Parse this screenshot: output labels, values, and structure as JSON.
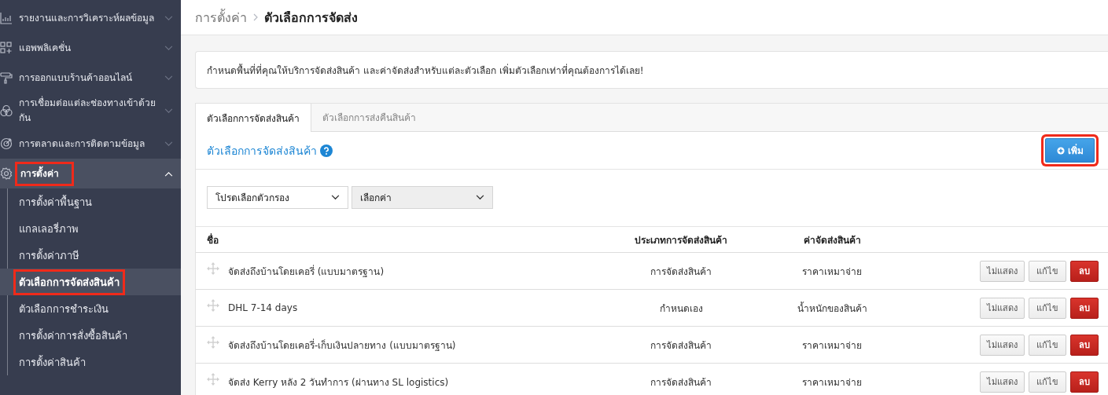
{
  "sidebar": {
    "items": [
      {
        "kind": "chart",
        "label": "รายงานและการวิเคราะห์ผลข้อมูล",
        "expanded": false,
        "selected": false,
        "highlighted": false
      },
      {
        "kind": "apps",
        "label": "แอพพลิเคชั่น",
        "expanded": false,
        "selected": false,
        "highlighted": false
      },
      {
        "kind": "roller",
        "label": "การออกแบบร้านค้าออนไลน์",
        "expanded": false,
        "selected": false,
        "highlighted": false
      },
      {
        "kind": "circles",
        "label": "การเชื่อมต่อแต่ละช่องทางเข้าด้วยกัน",
        "expanded": false,
        "selected": false,
        "highlighted": false
      },
      {
        "kind": "target",
        "label": "การตลาดและการติดตามข้อมูล",
        "expanded": false,
        "selected": false,
        "highlighted": false
      },
      {
        "kind": "gear",
        "label": "การตั้งค่า",
        "expanded": true,
        "selected": true,
        "highlighted": true,
        "children": [
          {
            "label": "การตั้งค่าพื้นฐาน",
            "selected": false,
            "highlighted": false
          },
          {
            "label": "แกลเลอรี่ภาพ",
            "selected": false,
            "highlighted": false
          },
          {
            "label": "การตั้งค่าภาษี",
            "selected": false,
            "highlighted": false
          },
          {
            "label": "ตัวเลือกการจัดส่งสินค้า",
            "selected": true,
            "highlighted": true
          },
          {
            "label": "ตัวเลือกการชำระเงิน",
            "selected": false,
            "highlighted": false
          },
          {
            "label": "การตั้งค่าการสั่งซื้อสินค้า",
            "selected": false,
            "highlighted": false
          },
          {
            "label": "การตั้งค่าสินค้า",
            "selected": false,
            "highlighted": false
          }
        ]
      }
    ]
  },
  "breadcrumb": [
    "การตั้งค่า",
    "ตัวเลือกการจัดส่ง"
  ],
  "info": "กำหนดพื้นที่ที่คุณให้บริการจัดส่งสินค้า และค่าจัดส่งสำหรับแต่ละตัวเลือก เพิ่มตัวเลือกเท่าที่คุณต้องการได้เลย!",
  "tabs": [
    {
      "label": "ตัวเลือกการจัดส่งสินค้า",
      "selected": true
    },
    {
      "label": "ตัวเลือกการส่งคืนสินค้า",
      "selected": false
    }
  ],
  "section": {
    "title": "ตัวเลือกการจัดส่งสินค้า",
    "add_button": {
      "label": "เพิ่ม",
      "highlighted": true
    }
  },
  "filters": [
    {
      "value": "โปรดเลือกตัวกรอง",
      "disabled": false
    },
    {
      "value": "เลือกค่า",
      "disabled": true
    }
  ],
  "table": {
    "columns": [
      "ชื่อ",
      "ประเภทการจัดส่งสินค้า",
      "ค่าจัดส่งสินค้า"
    ],
    "rows": [
      {
        "name": "จัดส่งถึงบ้านโดยเคอรี่ (แบบมาตรฐาน)",
        "type": "การจัดส่งสินค้า",
        "fee": "ราคาเหมาจ่าย",
        "actions": [
          {
            "kind": "default",
            "label": "ไม่แสดง"
          },
          {
            "kind": "default",
            "label": "แก้ไข"
          },
          {
            "kind": "danger",
            "label": "ลบ"
          }
        ]
      },
      {
        "name": "DHL 7-14 days",
        "type": "กำหนดเอง",
        "fee": "น้ำหนักของสินค้า",
        "actions": [
          {
            "kind": "default",
            "label": "ไม่แสดง"
          },
          {
            "kind": "default",
            "label": "แก้ไข"
          },
          {
            "kind": "danger",
            "label": "ลบ"
          }
        ]
      },
      {
        "name": "จัดส่งถึงบ้านโดยเคอรี่-เก็บเงินปลายทาง (แบบมาตรฐาน)",
        "type": "การจัดส่งสินค้า",
        "fee": "ราคาเหมาจ่าย",
        "actions": [
          {
            "kind": "default",
            "label": "ไม่แสดง"
          },
          {
            "kind": "default",
            "label": "แก้ไข"
          },
          {
            "kind": "danger",
            "label": "ลบ"
          }
        ]
      },
      {
        "name": "จัดส่ง Kerry หลัง 2 วันทำการ (ผ่านทาง SL logistics)",
        "type": "การจัดส่งสินค้า",
        "fee": "ราคาเหมาจ่าย",
        "actions": [
          {
            "kind": "default",
            "label": "ไม่แสดง"
          },
          {
            "kind": "default",
            "label": "แก้ไข"
          },
          {
            "kind": "danger",
            "label": "ลบ"
          }
        ]
      }
    ]
  }
}
